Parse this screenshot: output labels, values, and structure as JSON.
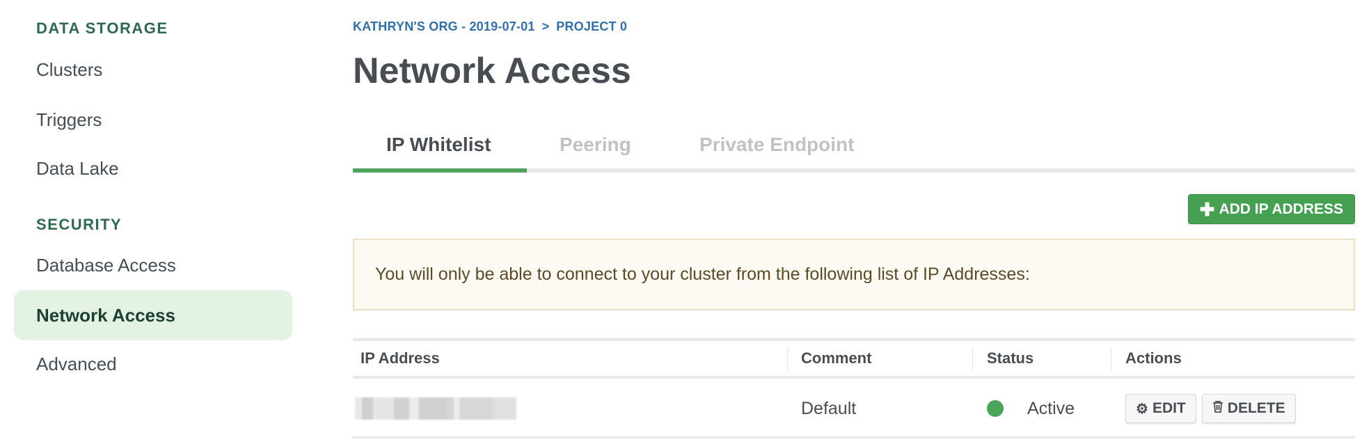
{
  "sidebar": {
    "sections": [
      {
        "heading": "DATA STORAGE",
        "items": [
          {
            "label": "Clusters",
            "active": false
          },
          {
            "label": "Triggers",
            "active": false
          },
          {
            "label": "Data Lake",
            "active": false
          }
        ]
      },
      {
        "heading": "SECURITY",
        "items": [
          {
            "label": "Database Access",
            "active": false
          },
          {
            "label": "Network Access",
            "active": true
          },
          {
            "label": "Advanced",
            "active": false
          }
        ]
      }
    ]
  },
  "breadcrumb": {
    "org": "KATHRYN'S ORG - 2019-07-01",
    "separator": ">",
    "project": "PROJECT 0"
  },
  "page": {
    "title": "Network Access"
  },
  "tabs": [
    {
      "label": "IP Whitelist",
      "active": true
    },
    {
      "label": "Peering",
      "active": false
    },
    {
      "label": "Private Endpoint",
      "active": false
    }
  ],
  "toolbar": {
    "add_icon": "plus-icon",
    "add_label": "ADD IP ADDRESS"
  },
  "notice": {
    "text": "You will only be able to connect to your cluster from the following list of IP Addresses:"
  },
  "table": {
    "columns": [
      "IP Address",
      "Comment",
      "Status",
      "Actions"
    ],
    "rows": [
      {
        "ip_address": "[redacted]",
        "comment": "Default",
        "status": "Active",
        "actions": {
          "edit_icon": "gear-icon",
          "edit_label": "EDIT",
          "delete_icon": "trash-icon",
          "delete_label": "DELETE"
        }
      }
    ]
  },
  "colors": {
    "accent_green": "#46a052",
    "status_active": "#4ba559",
    "breadcrumb_blue": "#2f6fae",
    "sidebar_heading": "#2c6a4e",
    "active_nav_bg": "#e4f2e3"
  }
}
